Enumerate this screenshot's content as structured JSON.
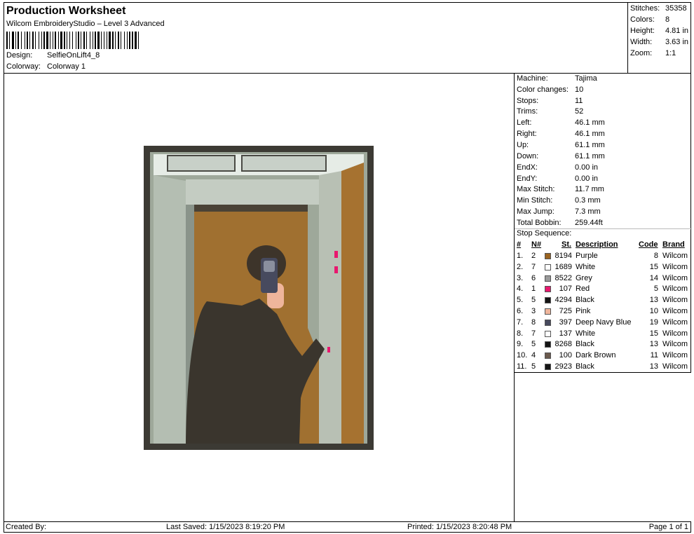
{
  "header": {
    "title": "Production Worksheet",
    "subtitle": "Wilcom EmbroideryStudio – Level 3 Advanced",
    "design_label": "Design:",
    "design_value": "SelfieOnLift4_8",
    "colorway_label": "Colorway:",
    "colorway_value": "Colorway 1"
  },
  "stats": [
    {
      "label": "Stitches:",
      "value": "35358"
    },
    {
      "label": "Colors:",
      "value": "8"
    },
    {
      "label": "Height:",
      "value": "4.81 in"
    },
    {
      "label": "Width:",
      "value": "3.63 in"
    },
    {
      "label": "Zoom:",
      "value": "1:1"
    }
  ],
  "machine_info": [
    {
      "label": "Machine:",
      "value": "Tajima"
    },
    {
      "label": "Color changes:",
      "value": "10"
    },
    {
      "label": "Stops:",
      "value": "11"
    },
    {
      "label": "Trims:",
      "value": "52"
    },
    {
      "label": "Left:",
      "value": "46.1 mm"
    },
    {
      "label": "Right:",
      "value": "46.1 mm"
    },
    {
      "label": "Up:",
      "value": "61.1 mm"
    },
    {
      "label": "Down:",
      "value": "61.1 mm"
    },
    {
      "label": "EndX:",
      "value": "0.00 in"
    },
    {
      "label": "EndY:",
      "value": "0.00 in"
    },
    {
      "label": "Max Stitch:",
      "value": "11.7 mm"
    },
    {
      "label": "Min Stitch:",
      "value": "0.3 mm"
    },
    {
      "label": "Max Jump:",
      "value": "7.3 mm"
    },
    {
      "label": "Total Bobbin:",
      "value": "259.44ft"
    }
  ],
  "stop_sequence": {
    "title": "Stop Sequence:",
    "headers": {
      "idx": "#",
      "n": "N#",
      "st": "St.",
      "desc": "Description",
      "code": "Code",
      "brand": "Brand"
    },
    "rows": [
      {
        "idx": "1.",
        "n": "2",
        "st": "8194",
        "color": "#9a6320",
        "desc": "Purple",
        "code": "8",
        "brand": "Wilcom"
      },
      {
        "idx": "2.",
        "n": "7",
        "st": "1689",
        "color": "#ffffff",
        "desc": "White",
        "code": "15",
        "brand": "Wilcom"
      },
      {
        "idx": "3.",
        "n": "6",
        "st": "8522",
        "color": "#9a9a9a",
        "desc": "Grey",
        "code": "14",
        "brand": "Wilcom"
      },
      {
        "idx": "4.",
        "n": "1",
        "st": "107",
        "color": "#e8186e",
        "desc": "Red",
        "code": "5",
        "brand": "Wilcom"
      },
      {
        "idx": "5.",
        "n": "5",
        "st": "4294",
        "color": "#141414",
        "desc": "Black",
        "code": "13",
        "brand": "Wilcom"
      },
      {
        "idx": "6.",
        "n": "3",
        "st": "725",
        "color": "#efb59b",
        "desc": "Pink",
        "code": "10",
        "brand": "Wilcom"
      },
      {
        "idx": "7.",
        "n": "8",
        "st": "397",
        "color": "#474a5e",
        "desc": "Deep Navy Blue",
        "code": "19",
        "brand": "Wilcom"
      },
      {
        "idx": "8.",
        "n": "7",
        "st": "137",
        "color": "#ffffff",
        "desc": "White",
        "code": "15",
        "brand": "Wilcom"
      },
      {
        "idx": "9.",
        "n": "5",
        "st": "8268",
        "color": "#141414",
        "desc": "Black",
        "code": "13",
        "brand": "Wilcom"
      },
      {
        "idx": "10.",
        "n": "4",
        "st": "100",
        "color": "#6b5a4e",
        "desc": "Dark Brown",
        "code": "11",
        "brand": "Wilcom"
      },
      {
        "idx": "11.",
        "n": "5",
        "st": "2923",
        "color": "#141414",
        "desc": "Black",
        "code": "13",
        "brand": "Wilcom"
      }
    ]
  },
  "footer": {
    "created_by": "Created By:",
    "last_saved": "Last Saved: 1/15/2023 8:19:20 PM",
    "printed": "Printed: 1/15/2023 8:20:48 PM",
    "page": "Page 1 of 1"
  }
}
